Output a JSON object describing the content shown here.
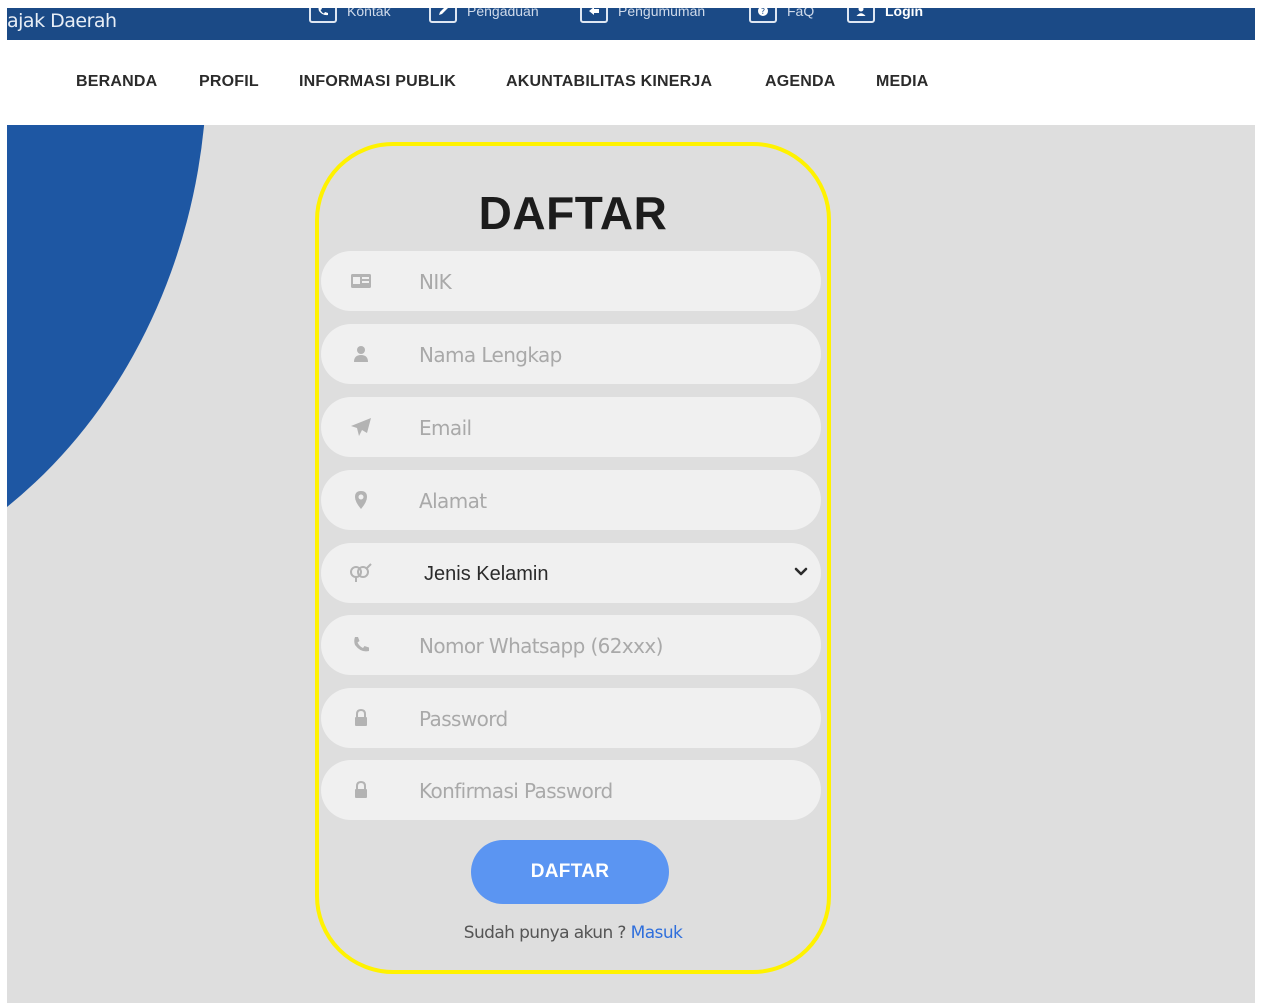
{
  "topbar": {
    "brand": "ajak Daerah",
    "links": [
      {
        "label": "Kontak",
        "icon": "phone-icon"
      },
      {
        "label": "Pengaduan",
        "icon": "edit-icon"
      },
      {
        "label": "Pengumuman",
        "icon": "announcement-icon"
      },
      {
        "label": "FaQ",
        "icon": "question-icon"
      },
      {
        "label": "Login",
        "icon": "user-icon"
      }
    ]
  },
  "nav": {
    "items": [
      "BERANDA",
      "PROFIL",
      "INFORMASI PUBLIK",
      "AKUNTABILITAS KINERJA",
      "AGENDA",
      "MEDIA"
    ]
  },
  "form": {
    "title": "DAFTAR",
    "fields": {
      "nik": {
        "placeholder": "NIK",
        "icon": "id-card-icon"
      },
      "name": {
        "placeholder": "Nama Lengkap",
        "icon": "user-icon"
      },
      "email": {
        "placeholder": "Email",
        "icon": "paper-plane-icon"
      },
      "address": {
        "placeholder": "Alamat",
        "icon": "map-marker-icon"
      },
      "gender": {
        "value": "Jenis Kelamin",
        "icon": "gender-icon"
      },
      "whatsapp": {
        "placeholder": "Nomor Whatsapp (62xxx)",
        "icon": "phone-icon"
      },
      "password": {
        "placeholder": "Password",
        "icon": "lock-icon"
      },
      "confirm_password": {
        "placeholder": "Konfirmasi Password",
        "icon": "lock-icon"
      }
    },
    "submit_label": "DAFTAR",
    "footer_text": "Sudah punya akun ?",
    "footer_link": "Masuk"
  },
  "colors": {
    "topbar": "#1b4a86",
    "arc": "#1e57a3",
    "background": "#dedede",
    "highlight_border": "#fff200",
    "button": "#5b95f2",
    "link": "#2f6fdc"
  }
}
